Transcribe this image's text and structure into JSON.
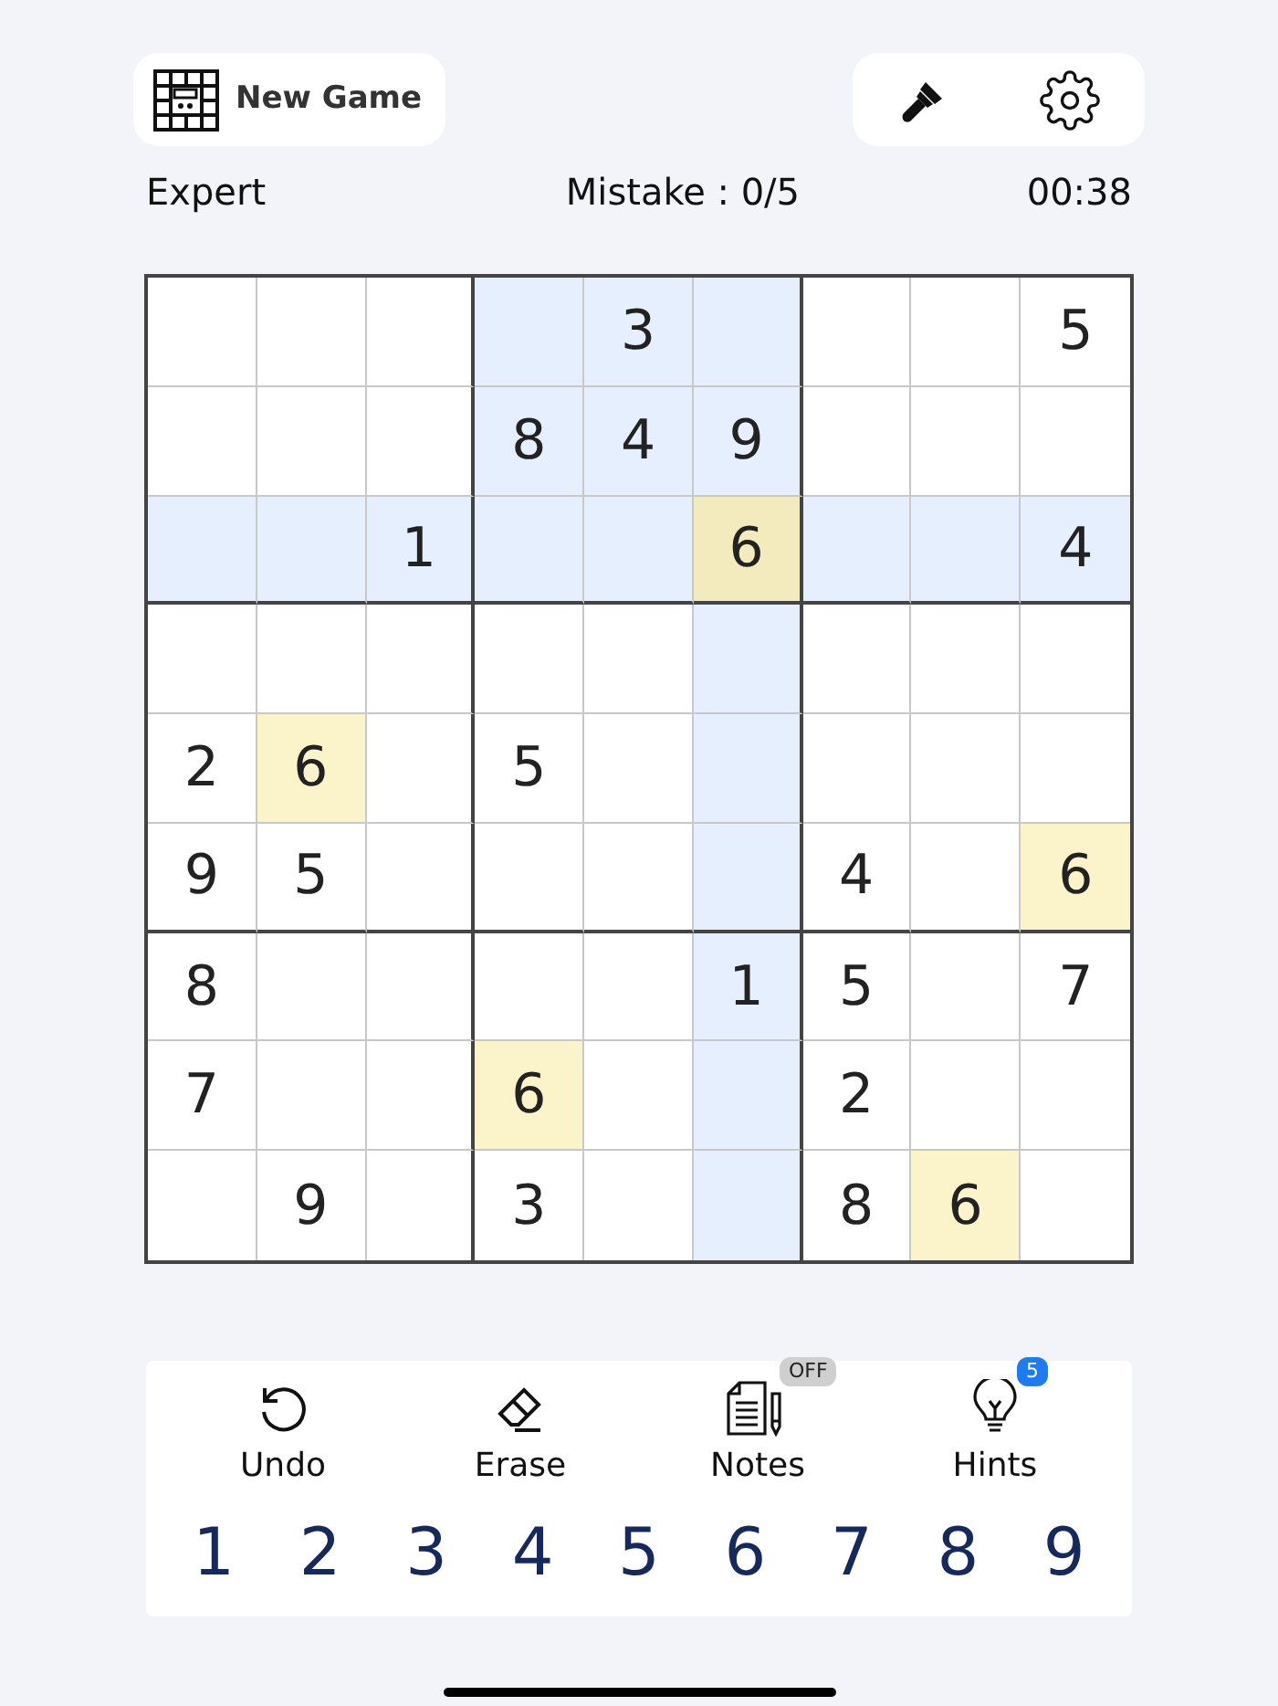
{
  "header": {
    "new_game": "New Game"
  },
  "status": {
    "difficulty": "Expert",
    "mistakes": "Mistake : 0/5",
    "timer": "00:38"
  },
  "board": {
    "rows": [
      [
        {
          "highlighted": false,
          "same_number": false,
          "selected": false
        },
        {
          "highlighted": false,
          "same_number": false,
          "selected": false
        },
        {
          "highlighted": false,
          "same_number": false,
          "selected": false
        },
        {
          "highlighted": true,
          "same_number": false,
          "selected": false
        },
        {
          "value": "3",
          "highlighted": true,
          "same_number": false,
          "selected": false
        },
        {
          "highlighted": true,
          "same_number": false,
          "selected": false
        },
        {
          "highlighted": false,
          "same_number": false,
          "selected": false
        },
        {
          "highlighted": false,
          "same_number": false,
          "selected": false
        },
        {
          "value": "5",
          "highlighted": false,
          "same_number": false,
          "selected": false
        }
      ],
      [
        {
          "highlighted": false,
          "same_number": false,
          "selected": false
        },
        {
          "highlighted": false,
          "same_number": false,
          "selected": false
        },
        {
          "highlighted": false,
          "same_number": false,
          "selected": false
        },
        {
          "value": "8",
          "highlighted": true,
          "same_number": false,
          "selected": false
        },
        {
          "value": "4",
          "highlighted": true,
          "same_number": false,
          "selected": false
        },
        {
          "value": "9",
          "highlighted": true,
          "same_number": false,
          "selected": false
        },
        {
          "highlighted": false,
          "same_number": false,
          "selected": false
        },
        {
          "highlighted": false,
          "same_number": false,
          "selected": false
        },
        {
          "highlighted": false,
          "same_number": false,
          "selected": false
        }
      ],
      [
        {
          "highlighted": true,
          "same_number": false,
          "selected": false
        },
        {
          "highlighted": true,
          "same_number": false,
          "selected": false
        },
        {
          "value": "1",
          "highlighted": true,
          "same_number": false,
          "selected": false
        },
        {
          "highlighted": true,
          "same_number": false,
          "selected": false
        },
        {
          "highlighted": true,
          "same_number": false,
          "selected": false
        },
        {
          "value": "6",
          "highlighted": false,
          "same_number": true,
          "selected": true
        },
        {
          "highlighted": true,
          "same_number": false,
          "selected": false
        },
        {
          "highlighted": true,
          "same_number": false,
          "selected": false
        },
        {
          "value": "4",
          "highlighted": true,
          "same_number": false,
          "selected": false
        }
      ],
      [
        {
          "highlighted": false,
          "same_number": false,
          "selected": false
        },
        {
          "highlighted": false,
          "same_number": false,
          "selected": false
        },
        {
          "highlighted": false,
          "same_number": false,
          "selected": false
        },
        {
          "highlighted": false,
          "same_number": false,
          "selected": false
        },
        {
          "highlighted": false,
          "same_number": false,
          "selected": false
        },
        {
          "highlighted": true,
          "same_number": false,
          "selected": false
        },
        {
          "highlighted": false,
          "same_number": false,
          "selected": false
        },
        {
          "highlighted": false,
          "same_number": false,
          "selected": false
        },
        {
          "highlighted": false,
          "same_number": false,
          "selected": false
        }
      ],
      [
        {
          "value": "2",
          "highlighted": false,
          "same_number": false,
          "selected": false
        },
        {
          "value": "6",
          "highlighted": false,
          "same_number": true,
          "selected": false
        },
        {
          "highlighted": false,
          "same_number": false,
          "selected": false
        },
        {
          "value": "5",
          "highlighted": false,
          "same_number": false,
          "selected": false
        },
        {
          "highlighted": false,
          "same_number": false,
          "selected": false
        },
        {
          "highlighted": true,
          "same_number": false,
          "selected": false
        },
        {
          "highlighted": false,
          "same_number": false,
          "selected": false
        },
        {
          "highlighted": false,
          "same_number": false,
          "selected": false
        },
        {
          "highlighted": false,
          "same_number": false,
          "selected": false
        }
      ],
      [
        {
          "value": "9",
          "highlighted": false,
          "same_number": false,
          "selected": false
        },
        {
          "value": "5",
          "highlighted": false,
          "same_number": false,
          "selected": false
        },
        {
          "highlighted": false,
          "same_number": false,
          "selected": false
        },
        {
          "highlighted": false,
          "same_number": false,
          "selected": false
        },
        {
          "highlighted": false,
          "same_number": false,
          "selected": false
        },
        {
          "highlighted": true,
          "same_number": false,
          "selected": false
        },
        {
          "value": "4",
          "highlighted": false,
          "same_number": false,
          "selected": false
        },
        {
          "highlighted": false,
          "same_number": false,
          "selected": false
        },
        {
          "value": "6",
          "highlighted": false,
          "same_number": true,
          "selected": false
        }
      ],
      [
        {
          "value": "8",
          "highlighted": false,
          "same_number": false,
          "selected": false
        },
        {
          "highlighted": false,
          "same_number": false,
          "selected": false
        },
        {
          "highlighted": false,
          "same_number": false,
          "selected": false
        },
        {
          "highlighted": false,
          "same_number": false,
          "selected": false
        },
        {
          "highlighted": false,
          "same_number": false,
          "selected": false
        },
        {
          "value": "1",
          "highlighted": true,
          "same_number": false,
          "selected": false
        },
        {
          "value": "5",
          "highlighted": false,
          "same_number": false,
          "selected": false
        },
        {
          "highlighted": false,
          "same_number": false,
          "selected": false
        },
        {
          "value": "7",
          "highlighted": false,
          "same_number": false,
          "selected": false
        }
      ],
      [
        {
          "value": "7",
          "highlighted": false,
          "same_number": false,
          "selected": false
        },
        {
          "highlighted": false,
          "same_number": false,
          "selected": false
        },
        {
          "highlighted": false,
          "same_number": false,
          "selected": false
        },
        {
          "value": "6",
          "highlighted": false,
          "same_number": true,
          "selected": false
        },
        {
          "highlighted": false,
          "same_number": false,
          "selected": false
        },
        {
          "highlighted": true,
          "same_number": false,
          "selected": false
        },
        {
          "value": "2",
          "highlighted": false,
          "same_number": false,
          "selected": false
        },
        {
          "highlighted": false,
          "same_number": false,
          "selected": false
        },
        {
          "highlighted": false,
          "same_number": false,
          "selected": false
        }
      ],
      [
        {
          "highlighted": false,
          "same_number": false,
          "selected": false
        },
        {
          "value": "9",
          "highlighted": false,
          "same_number": false,
          "selected": false
        },
        {
          "highlighted": false,
          "same_number": false,
          "selected": false
        },
        {
          "value": "3",
          "highlighted": false,
          "same_number": false,
          "selected": false
        },
        {
          "highlighted": false,
          "same_number": false,
          "selected": false
        },
        {
          "highlighted": true,
          "same_number": false,
          "selected": false
        },
        {
          "value": "8",
          "highlighted": false,
          "same_number": false,
          "selected": false
        },
        {
          "value": "6",
          "highlighted": false,
          "same_number": true,
          "selected": false
        },
        {
          "highlighted": false,
          "same_number": false,
          "selected": false
        }
      ]
    ]
  },
  "tools": [
    {
      "kind": "undo",
      "label": "Undo"
    },
    {
      "kind": "erase",
      "label": "Erase"
    },
    {
      "kind": "notes",
      "label": "Notes",
      "badge": "OFF"
    },
    {
      "kind": "hints",
      "label": "Hints",
      "badge": "5"
    }
  ],
  "numpad": [
    "1",
    "2",
    "3",
    "4",
    "5",
    "6",
    "7",
    "8",
    "9"
  ]
}
